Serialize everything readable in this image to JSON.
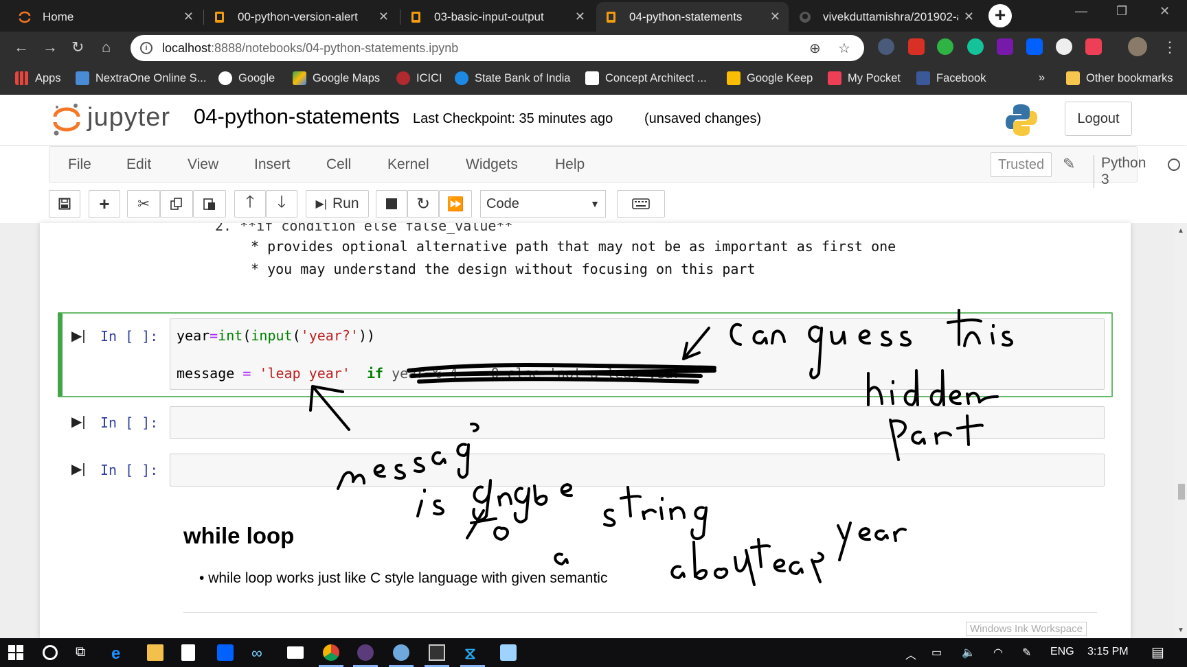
{
  "browser": {
    "tabs": [
      {
        "title": "Home",
        "active": false
      },
      {
        "title": "00-python-version-alert",
        "active": false
      },
      {
        "title": "03-basic-input-output",
        "active": false
      },
      {
        "title": "04-python-statements",
        "active": true
      },
      {
        "title": "vivekduttamishra/201902-a",
        "active": false
      }
    ],
    "url_host": "localhost",
    "url_rest": ":8888/notebooks/04-python-statements.ipynb",
    "bookmarks": [
      "Apps",
      "NextraOne Online S...",
      "Google",
      "Google Maps",
      "ICICI",
      "State Bank of India",
      "Concept Architect ...",
      "Google Keep",
      "My Pocket",
      "Facebook"
    ],
    "bookmarks_overflow": "»",
    "other_bookmarks": "Other bookmarks"
  },
  "jupyter": {
    "logo_text": "jupyter",
    "notebook_name": "04-python-statements",
    "checkpoint": "Last Checkpoint: 35 minutes ago",
    "unsaved": "(unsaved changes)",
    "logout": "Logout",
    "menus": [
      "File",
      "Edit",
      "View",
      "Insert",
      "Cell",
      "Kernel",
      "Widgets",
      "Help"
    ],
    "trusted": "Trusted",
    "kernel": "Python 3",
    "run_label": "Run",
    "cell_type": "Code"
  },
  "notebook": {
    "partial_line": "2. **if condition else false_value**",
    "line1": "* provides optional alternative path that may not be as important as first one",
    "line2": "* you may understand the design without focusing on this part",
    "prompt": "In [ ]:",
    "code_line1": {
      "a": "year",
      "b": "=",
      "c": "int",
      "d": "(",
      "e": "input",
      "f": "(",
      "g": "'year?'",
      "h": "))"
    },
    "code_line2": {
      "a": "message ",
      "b": "=",
      "c": " ",
      "d": "'leap year'",
      "e": "  ",
      "f": "if",
      "g": " year % 4 == 0 else 'not a leap year'"
    },
    "heading": "while loop",
    "bullet": "while loop works just like C style language with given semantic"
  },
  "ink_workspace": "Windows Ink Workspace",
  "taskbar": {
    "lang": "ENG",
    "time": "3:15 PM"
  },
  "colors": {
    "selected_cell": "#42a548",
    "prompt": "#303f9f",
    "string": "#ba2121",
    "keyword": "#008000",
    "operator": "#aa22ff"
  }
}
